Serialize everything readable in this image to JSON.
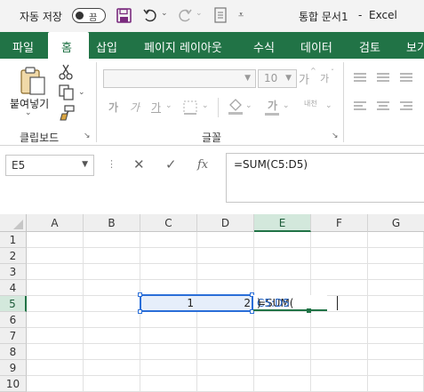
{
  "titlebar": {
    "autosave_label": "자동 저장",
    "autosave_state": "끔",
    "document_title": "통합 문서1",
    "separator": "-",
    "app_name": "Excel"
  },
  "tabs": [
    "파일",
    "홈",
    "삽입",
    "페이지 레이아웃",
    "수식",
    "데이터",
    "검토",
    "보기"
  ],
  "active_tab": "홈",
  "ribbon": {
    "clipboard": {
      "paste_label": "붙여넣기",
      "group_label": "클립보드"
    },
    "font": {
      "font_name": "",
      "font_size": "10",
      "grow_font": "가",
      "shrink_font": "가",
      "bold": "가",
      "italic": "가",
      "underline": "가",
      "font_color": "가",
      "phonetic": "내천",
      "group_label": "글꼴"
    }
  },
  "formula_bar": {
    "name_box": "E5",
    "formula": "=SUM(C5:D5)",
    "fx": "fx"
  },
  "grid": {
    "columns": [
      "A",
      "B",
      "C",
      "D",
      "E",
      "F",
      "G"
    ],
    "selected_column": "E",
    "rows": [
      "1",
      "2",
      "3",
      "4",
      "5",
      "6",
      "7",
      "8",
      "9",
      "10"
    ],
    "selected_row": "5",
    "cells": {
      "C5": "1",
      "D5": "2",
      "E5_prefix": "=SUM(",
      "E5_ref": "C5:D5",
      "E5_suffix": ")"
    }
  },
  "colors": {
    "ribbon_green": "#217346",
    "selection_blue": "#2a6ed8",
    "ref_blue": "#1f5fbf"
  }
}
